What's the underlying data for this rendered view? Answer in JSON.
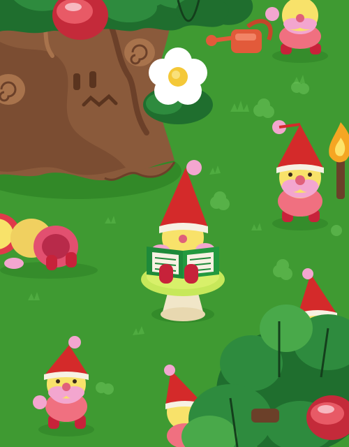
{
  "scene": {
    "colors": {
      "grass": "#3f9a32",
      "grass_light": "#4fae3b",
      "grass_dark": "#2f8426",
      "trunk": "#8a5a3b",
      "trunk_dark": "#6b4029",
      "bark_light": "#a8734c",
      "leaf_dark": "#1f6e2e",
      "leaf_mid": "#2e8b3e",
      "leaf_light": "#49a94a",
      "gnome_hat": "#d42a2a",
      "gnome_face": "#f8e26a",
      "gnome_beard": "#f3a6cf",
      "gnome_body": "#f07080",
      "gnome_boots": "#c7223a",
      "book": "#1e8a3a",
      "stool_top": "#c7e85a",
      "stool_base": "#f1e6c8",
      "berry": "#d93a4a",
      "flower_petal": "#ffffff",
      "flower_center": "#f4c838",
      "can": "#e25a3a",
      "flame": "#f5a623"
    },
    "characters": [
      {
        "name": "reading-gnome",
        "prop": "book"
      },
      {
        "name": "gnome-watering-can",
        "prop": "watering can"
      },
      {
        "name": "gnome-torch",
        "prop": "torch"
      },
      {
        "name": "gnome-bottom-left",
        "prop": "none"
      },
      {
        "name": "gnome-bottom-center",
        "prop": "none"
      },
      {
        "name": "gnome-right-peeking",
        "prop": "none"
      },
      {
        "name": "caterpillar-creature",
        "prop": "none"
      }
    ]
  }
}
